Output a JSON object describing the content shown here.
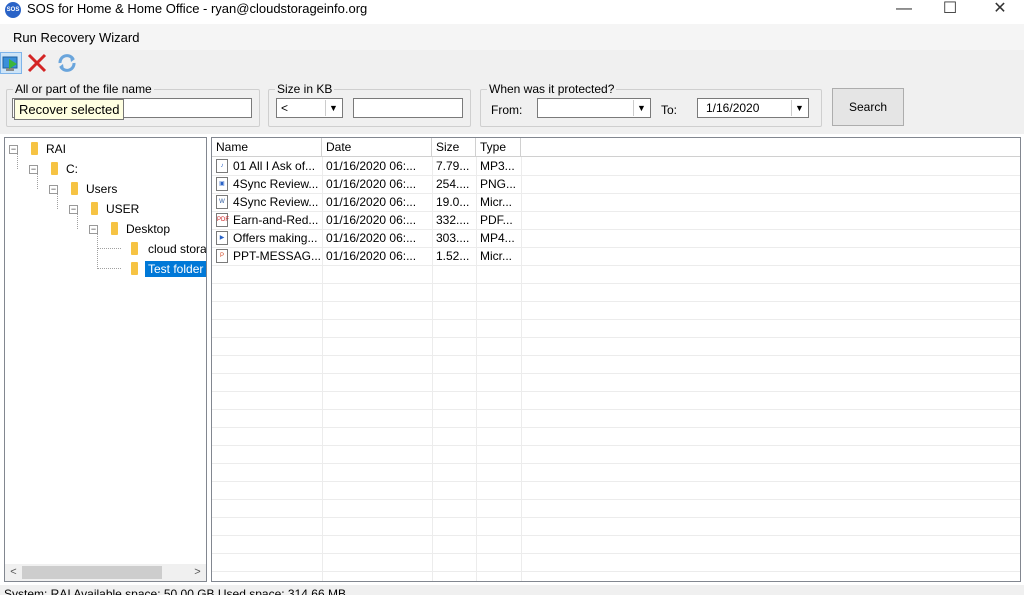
{
  "window": {
    "title": "SOS for Home & Home Office - ryan@cloudstorageinfo.org",
    "app_icon_text": "SOS",
    "minimize_glyph": "—",
    "maximize_glyph": "☐",
    "close_glyph": "✕"
  },
  "menu": {
    "run_recovery": "Run Recovery Wizard"
  },
  "toolbar": {
    "icons": [
      "recover-icon",
      "delete-icon",
      "refresh-icon"
    ],
    "tooltip": "Recover selected"
  },
  "filters": {
    "filename_group": "All or part of the file name",
    "filename_value": "",
    "size_group": "Size in KB",
    "size_operator": "<",
    "size_value": "",
    "protected_group": "When was it protected?",
    "from_label": "From:",
    "from_value": "",
    "to_label": "To:",
    "to_value": "1/16/2020",
    "search_label": "Search"
  },
  "tree": {
    "nodes": [
      {
        "label": "RAI"
      },
      {
        "label": "C:"
      },
      {
        "label": "Users"
      },
      {
        "label": "USER"
      },
      {
        "label": "Desktop"
      },
      {
        "label": "cloud stora"
      },
      {
        "label": "Test folder"
      }
    ],
    "expand_glyph": "−",
    "scroll_left": "<",
    "scroll_right": ">"
  },
  "list": {
    "columns": [
      "Name",
      "Date",
      "Size",
      "Type"
    ],
    "rows": [
      {
        "name": "01 All I Ask of...",
        "date": "01/16/2020 06:...",
        "size": "7.79...",
        "type": "MP3...",
        "icon": "audio-icon"
      },
      {
        "name": "4Sync Review...",
        "date": "01/16/2020 06:...",
        "size": "254....",
        "type": "PNG...",
        "icon": "image-icon"
      },
      {
        "name": "4Sync Review...",
        "date": "01/16/2020 06:...",
        "size": "19.0...",
        "type": "Micr...",
        "icon": "word-icon"
      },
      {
        "name": "Earn-and-Red...",
        "date": "01/16/2020 06:...",
        "size": "332....",
        "type": "PDF...",
        "icon": "pdf-icon"
      },
      {
        "name": "Offers making...",
        "date": "01/16/2020 06:...",
        "size": "303....",
        "type": "MP4...",
        "icon": "video-icon"
      },
      {
        "name": "PPT-MESSAG...",
        "date": "01/16/2020 06:...",
        "size": "1.52...",
        "type": "Micr...",
        "icon": "powerpoint-icon"
      }
    ]
  },
  "status": {
    "text": "System: RAI  Available space: 50.00 GB  Used space: 314.66 MB"
  },
  "colors": {
    "selection": "#0078d7",
    "folder": "#f6c343",
    "tooltip_bg": "#ffffe1"
  }
}
